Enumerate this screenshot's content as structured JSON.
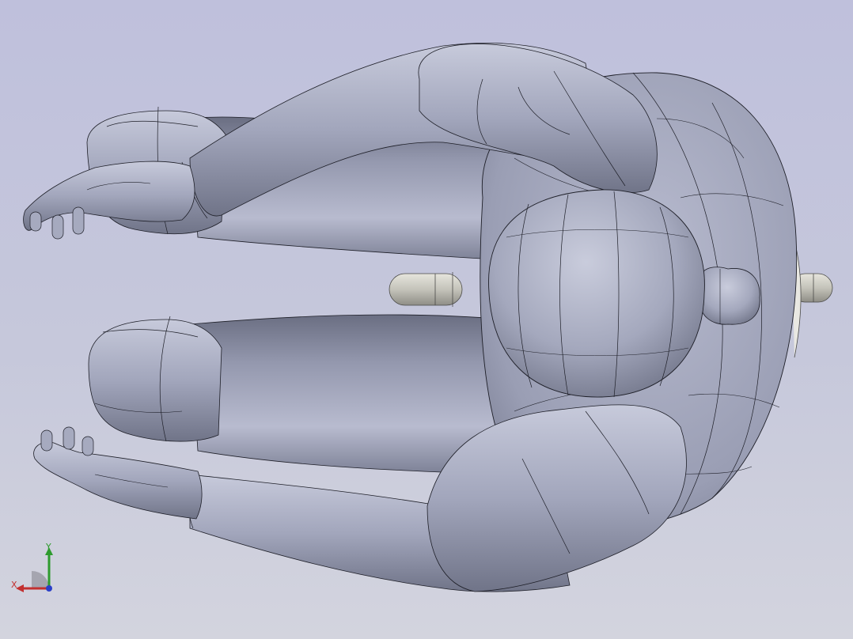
{
  "viewport": {
    "background_top": "#bfc0dc",
    "background_bottom": "#d3d4de",
    "model_color": "#9da1b6"
  },
  "triad": {
    "x_label": "X",
    "y_label": "Y",
    "x_color": "#c23030",
    "y_color": "#2e9b2e",
    "z_color": "#2a3fc8"
  }
}
